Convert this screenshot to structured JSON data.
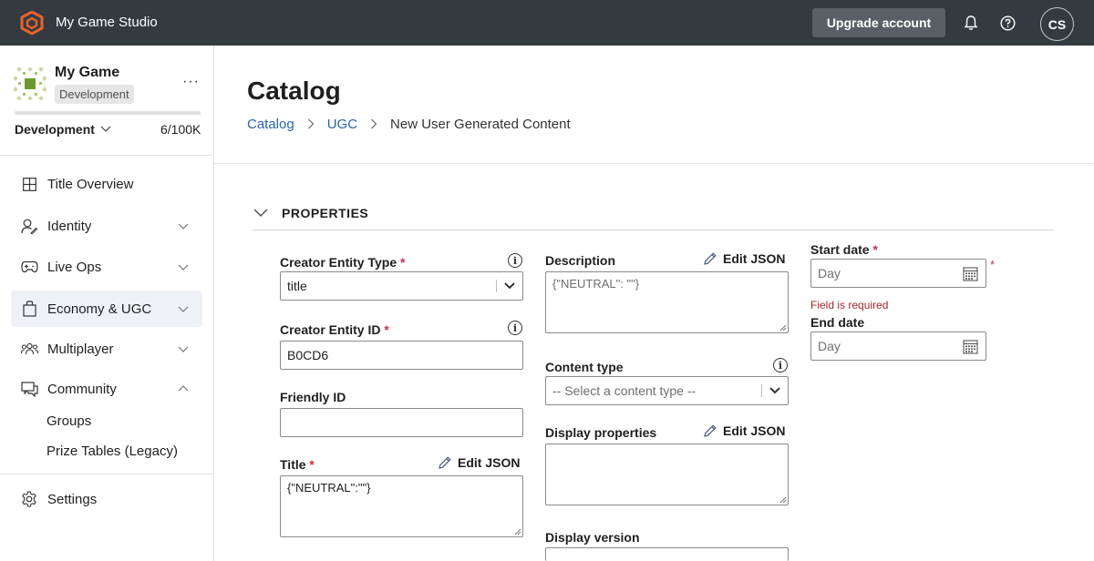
{
  "header": {
    "studio_name": "My Game Studio",
    "upgrade_label": "Upgrade account",
    "avatar_initials": "CS",
    "icons": [
      "bell-icon",
      "help-icon"
    ]
  },
  "sidebar": {
    "game_name": "My Game",
    "environment_badge": "Development",
    "environment_selected": "Development",
    "quota": "6/100K",
    "quota_fill_fraction": 0.0,
    "nav": [
      {
        "label": "Title Overview",
        "icon": "grid-icon",
        "expandable": false
      },
      {
        "label": "Identity",
        "icon": "identity-icon",
        "expandable": true
      },
      {
        "label": "Live Ops",
        "icon": "gamepad-icon",
        "expandable": true
      },
      {
        "label": "Economy & UGC",
        "icon": "bag-icon",
        "expandable": true,
        "active": true
      },
      {
        "label": "Multiplayer",
        "icon": "people-icon",
        "expandable": true
      },
      {
        "label": "Community",
        "icon": "chat-icon",
        "expandable": true,
        "expanded": true
      }
    ],
    "community_sub": [
      "Groups",
      "Prize Tables (Legacy)"
    ],
    "settings_label": "Settings"
  },
  "main": {
    "title": "Catalog",
    "breadcrumb": [
      "Catalog",
      "UGC",
      "New User Generated Content"
    ],
    "section_title": "PROPERTIES",
    "form": {
      "creator_entity_type": {
        "label": "Creator Entity Type",
        "required": "*",
        "value": "title"
      },
      "creator_entity_id": {
        "label": "Creator Entity ID",
        "required": "*",
        "value": "B0CD6"
      },
      "friendly_id": {
        "label": "Friendly ID",
        "value": ""
      },
      "title": {
        "label": "Title",
        "required": "*",
        "edit_json": "Edit JSON",
        "value": "{\"NEUTRAL\":\"\"}"
      },
      "description": {
        "label": "Description",
        "edit_json": "Edit JSON",
        "placeholder": "{\"NEUTRAL\": \"\"}"
      },
      "content_type": {
        "label": "Content type",
        "placeholder": "-- Select a content type --"
      },
      "display_properties": {
        "label": "Display properties",
        "edit_json": "Edit JSON",
        "value": ""
      },
      "display_version": {
        "label": "Display version",
        "value": ""
      },
      "start_date": {
        "label": "Start date",
        "required": "*",
        "placeholder": "Day",
        "error": "Field is required"
      },
      "end_date": {
        "label": "End date",
        "placeholder": "Day"
      }
    }
  },
  "colors": {
    "topbar": "#343a40",
    "link": "#2c64a6",
    "required": "#c4314b",
    "error": "#a4262c",
    "logo_orange": "#e8632b",
    "game_logo_green": "#8ab04a"
  }
}
